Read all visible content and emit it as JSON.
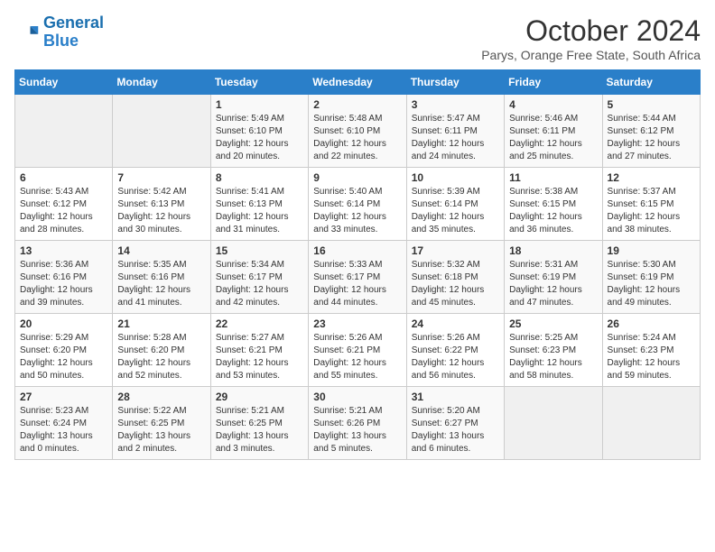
{
  "logo": {
    "line1": "General",
    "line2": "Blue"
  },
  "title": "October 2024",
  "subtitle": "Parys, Orange Free State, South Africa",
  "days_of_week": [
    "Sunday",
    "Monday",
    "Tuesday",
    "Wednesday",
    "Thursday",
    "Friday",
    "Saturday"
  ],
  "weeks": [
    [
      {
        "day": "",
        "detail": ""
      },
      {
        "day": "",
        "detail": ""
      },
      {
        "day": "1",
        "detail": "Sunrise: 5:49 AM\nSunset: 6:10 PM\nDaylight: 12 hours and 20 minutes."
      },
      {
        "day": "2",
        "detail": "Sunrise: 5:48 AM\nSunset: 6:10 PM\nDaylight: 12 hours and 22 minutes."
      },
      {
        "day": "3",
        "detail": "Sunrise: 5:47 AM\nSunset: 6:11 PM\nDaylight: 12 hours and 24 minutes."
      },
      {
        "day": "4",
        "detail": "Sunrise: 5:46 AM\nSunset: 6:11 PM\nDaylight: 12 hours and 25 minutes."
      },
      {
        "day": "5",
        "detail": "Sunrise: 5:44 AM\nSunset: 6:12 PM\nDaylight: 12 hours and 27 minutes."
      }
    ],
    [
      {
        "day": "6",
        "detail": "Sunrise: 5:43 AM\nSunset: 6:12 PM\nDaylight: 12 hours and 28 minutes."
      },
      {
        "day": "7",
        "detail": "Sunrise: 5:42 AM\nSunset: 6:13 PM\nDaylight: 12 hours and 30 minutes."
      },
      {
        "day": "8",
        "detail": "Sunrise: 5:41 AM\nSunset: 6:13 PM\nDaylight: 12 hours and 31 minutes."
      },
      {
        "day": "9",
        "detail": "Sunrise: 5:40 AM\nSunset: 6:14 PM\nDaylight: 12 hours and 33 minutes."
      },
      {
        "day": "10",
        "detail": "Sunrise: 5:39 AM\nSunset: 6:14 PM\nDaylight: 12 hours and 35 minutes."
      },
      {
        "day": "11",
        "detail": "Sunrise: 5:38 AM\nSunset: 6:15 PM\nDaylight: 12 hours and 36 minutes."
      },
      {
        "day": "12",
        "detail": "Sunrise: 5:37 AM\nSunset: 6:15 PM\nDaylight: 12 hours and 38 minutes."
      }
    ],
    [
      {
        "day": "13",
        "detail": "Sunrise: 5:36 AM\nSunset: 6:16 PM\nDaylight: 12 hours and 39 minutes."
      },
      {
        "day": "14",
        "detail": "Sunrise: 5:35 AM\nSunset: 6:16 PM\nDaylight: 12 hours and 41 minutes."
      },
      {
        "day": "15",
        "detail": "Sunrise: 5:34 AM\nSunset: 6:17 PM\nDaylight: 12 hours and 42 minutes."
      },
      {
        "day": "16",
        "detail": "Sunrise: 5:33 AM\nSunset: 6:17 PM\nDaylight: 12 hours and 44 minutes."
      },
      {
        "day": "17",
        "detail": "Sunrise: 5:32 AM\nSunset: 6:18 PM\nDaylight: 12 hours and 45 minutes."
      },
      {
        "day": "18",
        "detail": "Sunrise: 5:31 AM\nSunset: 6:19 PM\nDaylight: 12 hours and 47 minutes."
      },
      {
        "day": "19",
        "detail": "Sunrise: 5:30 AM\nSunset: 6:19 PM\nDaylight: 12 hours and 49 minutes."
      }
    ],
    [
      {
        "day": "20",
        "detail": "Sunrise: 5:29 AM\nSunset: 6:20 PM\nDaylight: 12 hours and 50 minutes."
      },
      {
        "day": "21",
        "detail": "Sunrise: 5:28 AM\nSunset: 6:20 PM\nDaylight: 12 hours and 52 minutes."
      },
      {
        "day": "22",
        "detail": "Sunrise: 5:27 AM\nSunset: 6:21 PM\nDaylight: 12 hours and 53 minutes."
      },
      {
        "day": "23",
        "detail": "Sunrise: 5:26 AM\nSunset: 6:21 PM\nDaylight: 12 hours and 55 minutes."
      },
      {
        "day": "24",
        "detail": "Sunrise: 5:26 AM\nSunset: 6:22 PM\nDaylight: 12 hours and 56 minutes."
      },
      {
        "day": "25",
        "detail": "Sunrise: 5:25 AM\nSunset: 6:23 PM\nDaylight: 12 hours and 58 minutes."
      },
      {
        "day": "26",
        "detail": "Sunrise: 5:24 AM\nSunset: 6:23 PM\nDaylight: 12 hours and 59 minutes."
      }
    ],
    [
      {
        "day": "27",
        "detail": "Sunrise: 5:23 AM\nSunset: 6:24 PM\nDaylight: 13 hours and 0 minutes."
      },
      {
        "day": "28",
        "detail": "Sunrise: 5:22 AM\nSunset: 6:25 PM\nDaylight: 13 hours and 2 minutes."
      },
      {
        "day": "29",
        "detail": "Sunrise: 5:21 AM\nSunset: 6:25 PM\nDaylight: 13 hours and 3 minutes."
      },
      {
        "day": "30",
        "detail": "Sunrise: 5:21 AM\nSunset: 6:26 PM\nDaylight: 13 hours and 5 minutes."
      },
      {
        "day": "31",
        "detail": "Sunrise: 5:20 AM\nSunset: 6:27 PM\nDaylight: 13 hours and 6 minutes."
      },
      {
        "day": "",
        "detail": ""
      },
      {
        "day": "",
        "detail": ""
      }
    ]
  ]
}
